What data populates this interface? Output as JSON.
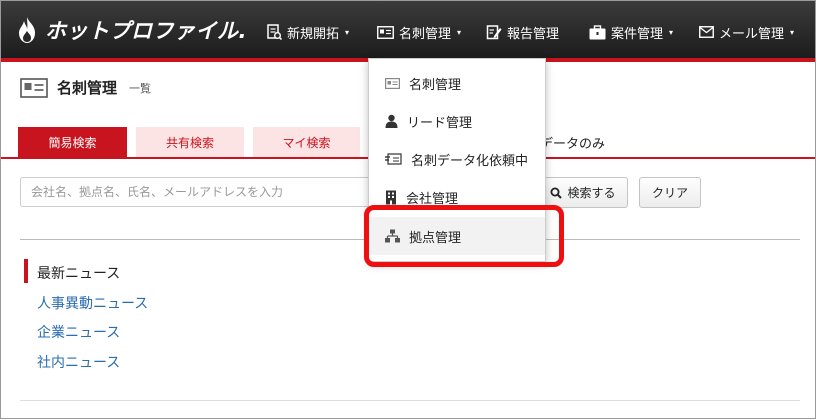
{
  "brand": {
    "logo_text": "ホットプロファイル."
  },
  "nav": [
    {
      "label": "新規開拓",
      "icon": "new-prospect-icon",
      "caret": "▾"
    },
    {
      "label": "名刺管理",
      "icon": "business-card-icon",
      "caret": "▾"
    },
    {
      "label": "報告管理",
      "icon": "report-edit-icon",
      "caret": ""
    },
    {
      "label": "案件管理",
      "icon": "briefcase-icon",
      "caret": "▾"
    },
    {
      "label": "メール管理",
      "icon": "mail-icon",
      "caret": "▾"
    }
  ],
  "page": {
    "title": "名刺管理",
    "subtitle": "一覧"
  },
  "tabs": [
    {
      "label": "簡易検索",
      "active": true
    },
    {
      "label": "共有検索",
      "active": false
    },
    {
      "label": "マイ検索",
      "active": false
    }
  ],
  "tab_extra": "データのみ",
  "search": {
    "placeholder": "会社名、拠点名、氏名、メールアドレスを入力",
    "value": "",
    "search_button": "検索する",
    "clear_button": "クリア"
  },
  "news": {
    "title": "最新ニュース",
    "links": [
      "人事異動ニュース",
      "企業ニュース",
      "社内ニュース"
    ]
  },
  "dropdown": {
    "items": [
      {
        "label": "名刺管理",
        "icon": "business-card-icon"
      },
      {
        "label": "リード管理",
        "icon": "person-icon"
      },
      {
        "label": "名刺データ化依頼中",
        "icon": "card-request-icon"
      },
      {
        "label": "会社管理",
        "icon": "building-icon"
      },
      {
        "label": "拠点管理",
        "icon": "branch-network-icon",
        "highlighted": true
      }
    ]
  },
  "colors": {
    "accent": "#c8141e",
    "topbar": "#2a2a2a",
    "link": "#2a6db0",
    "annotation": "#ee1010"
  }
}
